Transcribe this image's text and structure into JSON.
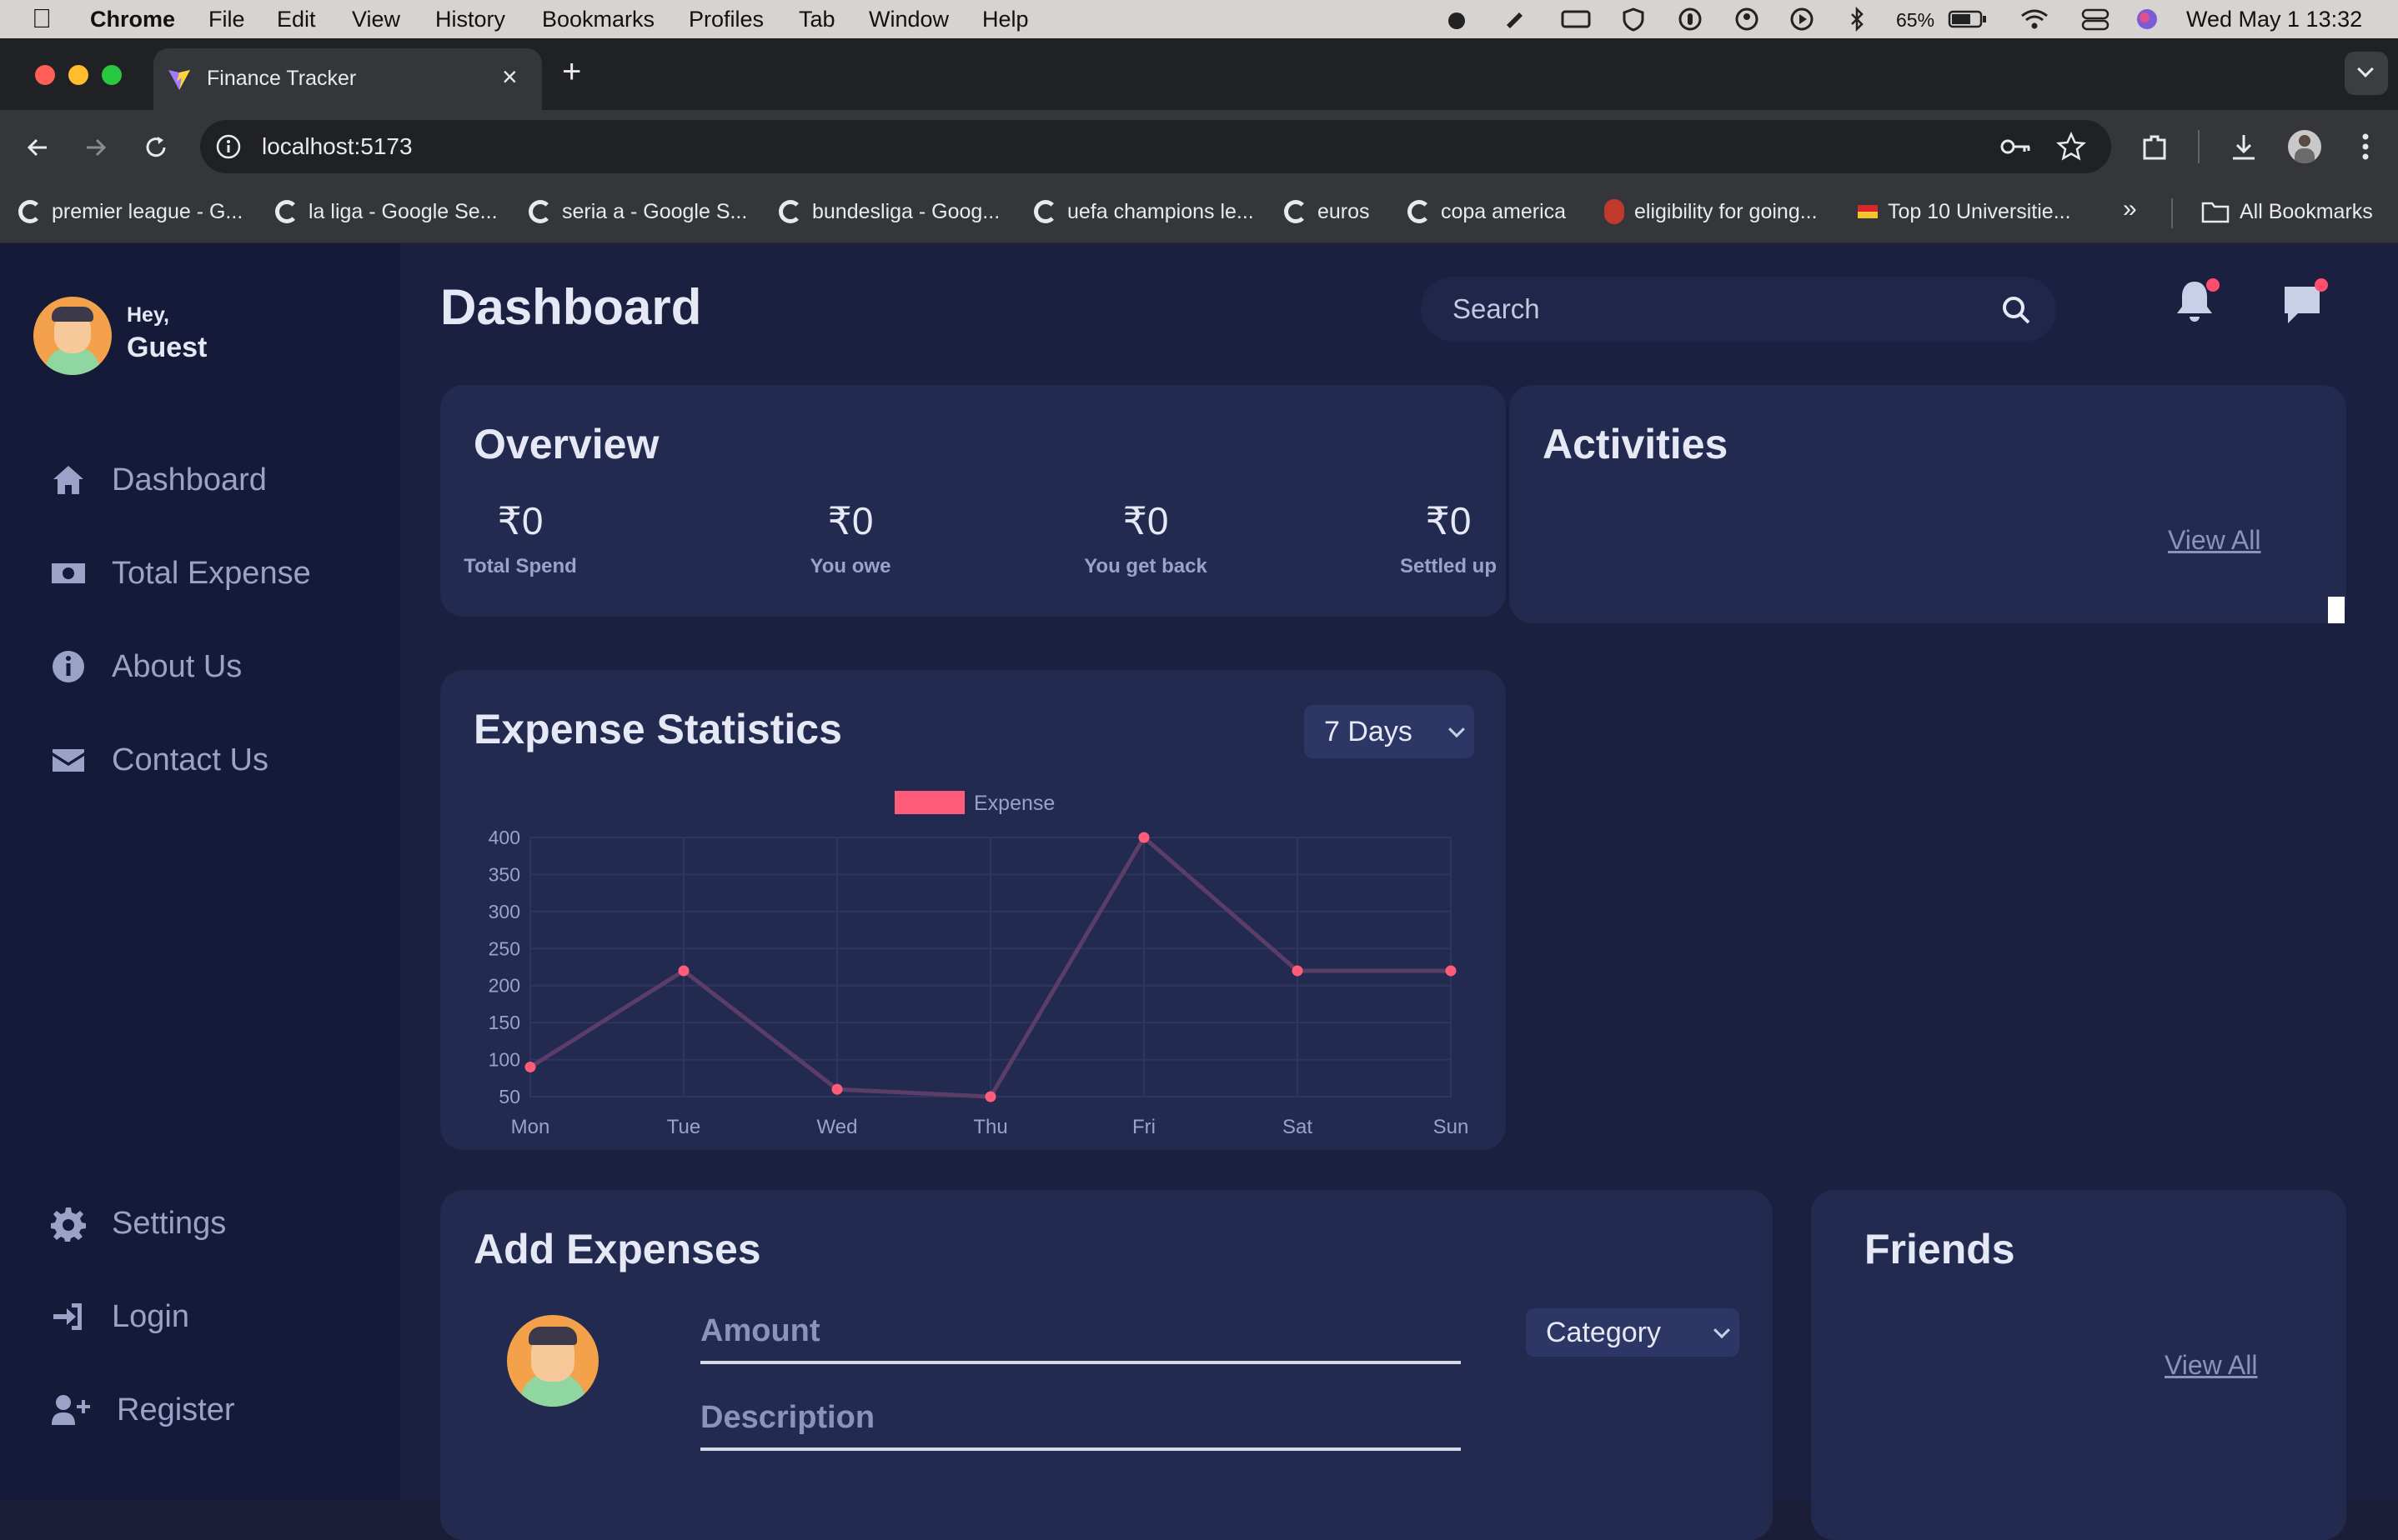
{
  "menubar": {
    "app": "Chrome",
    "items": [
      "File",
      "Edit",
      "View",
      "History",
      "Bookmarks",
      "Profiles",
      "Tab",
      "Window",
      "Help"
    ],
    "battery": "65%",
    "datetime": "Wed May 1  13:32"
  },
  "browser": {
    "tab_title": "Finance Tracker",
    "url": "localhost:5173",
    "bookmarks": [
      "premier league - G...",
      "la liga - Google Se...",
      "seria a - Google S...",
      "bundesliga - Goog...",
      "uefa champions le...",
      "euros",
      "copa america",
      "eligibility for going...",
      "Top 10 Universitie..."
    ],
    "all_bookmarks": "All Bookmarks"
  },
  "user": {
    "greeting": "Hey,",
    "name": "Guest"
  },
  "sidebar": {
    "items": [
      {
        "label": "Dashboard"
      },
      {
        "label": "Total Expense"
      },
      {
        "label": "About Us"
      },
      {
        "label": "Contact Us"
      }
    ],
    "bottom": [
      {
        "label": "Settings"
      },
      {
        "label": "Login"
      },
      {
        "label": "Register"
      }
    ]
  },
  "header": {
    "title": "Dashboard",
    "search_placeholder": "Search"
  },
  "overview": {
    "title": "Overview",
    "stats": [
      {
        "value": "₹0",
        "label": "Total Spend"
      },
      {
        "value": "₹0",
        "label": "You owe"
      },
      {
        "value": "₹0",
        "label": "You get back"
      },
      {
        "value": "₹0",
        "label": "Settled up"
      }
    ]
  },
  "activities": {
    "title": "Activities",
    "view_all": "View All"
  },
  "expense_stats": {
    "title": "Expense Statistics",
    "range": "7 Days"
  },
  "chart_data": {
    "type": "line",
    "categories": [
      "Mon",
      "Tue",
      "Wed",
      "Thu",
      "Fri",
      "Sat",
      "Sun"
    ],
    "series": [
      {
        "name": "Expense",
        "values": [
          90,
          220,
          60,
          50,
          400,
          220,
          220
        ],
        "color": "#ff5c7a"
      }
    ],
    "yticks": [
      50,
      100,
      150,
      200,
      250,
      300,
      350,
      400
    ],
    "ylim": [
      50,
      400
    ],
    "grid": true,
    "legend": "top-center"
  },
  "add_expenses": {
    "title": "Add Expenses",
    "amount": "Amount",
    "description": "Description",
    "category": "Category"
  },
  "friends": {
    "title": "Friends",
    "view_all": "View All"
  }
}
